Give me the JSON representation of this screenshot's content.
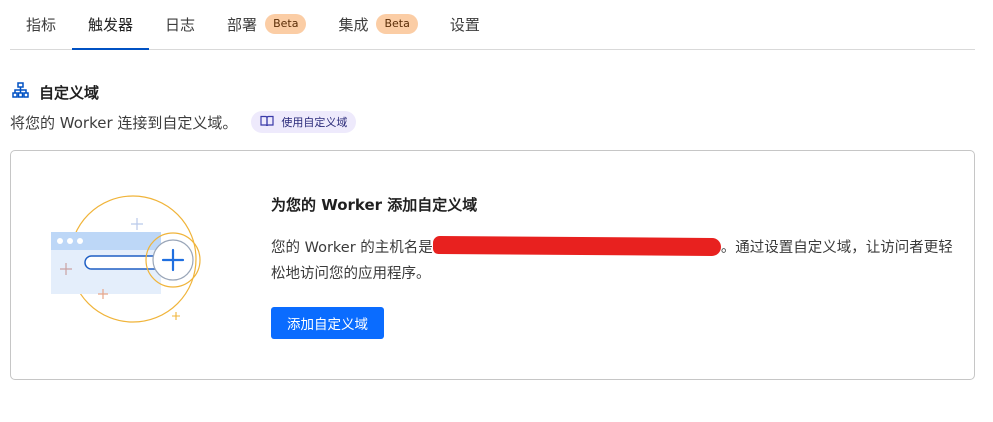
{
  "tabs": [
    {
      "label": "指标",
      "active": false,
      "badge": ""
    },
    {
      "label": "触发器",
      "active": true,
      "badge": ""
    },
    {
      "label": "日志",
      "active": false,
      "badge": ""
    },
    {
      "label": "部署",
      "active": false,
      "badge": "Beta"
    },
    {
      "label": "集成",
      "active": false,
      "badge": "Beta"
    },
    {
      "label": "设置",
      "active": false,
      "badge": ""
    }
  ],
  "section": {
    "icon": "sitemap-icon",
    "title": "自定义域",
    "description": "将您的 Worker 连接到自定义域。",
    "doc_link": {
      "icon": "book-icon",
      "label": "使用自定义域"
    }
  },
  "card": {
    "title": "为您的 Worker 添加自定义域",
    "body_before": "您的 Worker 的主机名是",
    "body_after": "。通过设置自定义域，让访问者更轻松地访问您的应用程序。",
    "button_label": "添加自定义域"
  },
  "colors": {
    "accent": "#0a6cff",
    "tab_underline": "#0051c3",
    "badge_bg": "#fbcda5",
    "pill_bg": "#eeeafc",
    "redaction": "#e8211f"
  }
}
